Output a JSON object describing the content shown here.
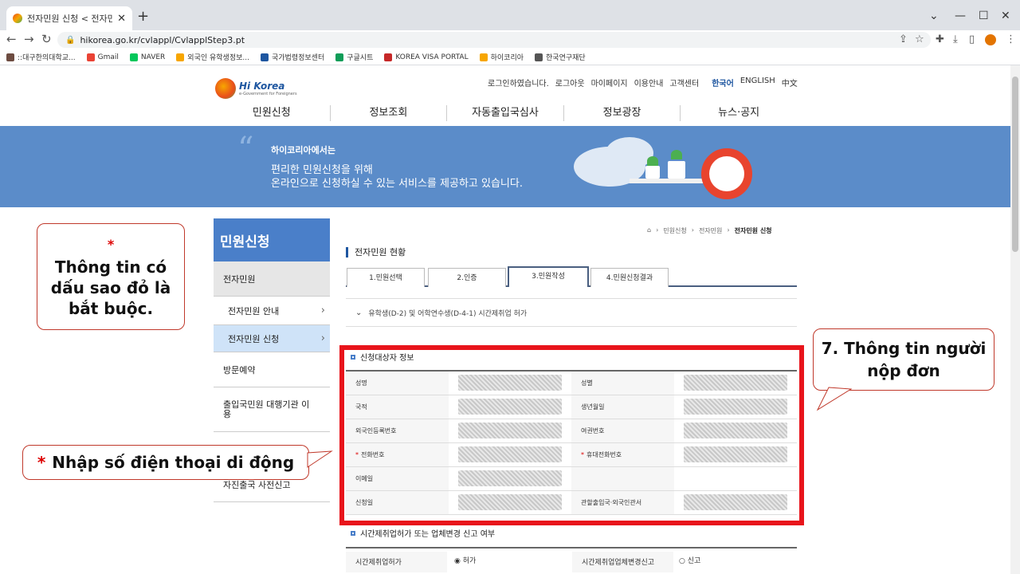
{
  "browser": {
    "tab_title": "전자민원 신청 < 전자민원 < 하",
    "url": "hikorea.go.kr/cvlappl/CvlapplStep3.pt",
    "bookmarks": [
      {
        "label": "::대구한의대학교...",
        "color": "#6d4c41"
      },
      {
        "label": "Gmail",
        "color": "#ea4335"
      },
      {
        "label": "NAVER",
        "color": "#03c75a"
      },
      {
        "label": "외국인 유학생정보...",
        "color": "#f7a600"
      },
      {
        "label": "국가법령정보센터",
        "color": "#1e56a0"
      },
      {
        "label": "구글시트",
        "color": "#0f9d58"
      },
      {
        "label": "KOREA VISA PORTAL",
        "color": "#c62828"
      },
      {
        "label": "하이코리아",
        "color": "#f7a600"
      },
      {
        "label": "한국연구재단",
        "color": "#555555"
      }
    ]
  },
  "header": {
    "logo_text": "Hi Korea",
    "logo_sub": "e-Government for Foreigners",
    "util": [
      "로그인하였습니다.",
      "로그아웃",
      "마이페이지",
      "이용안내",
      "고객센터"
    ],
    "langs": [
      "한국어",
      "ENGLISH",
      "中文"
    ],
    "gnb": [
      "민원신청",
      "정보조회",
      "자동출입국심사",
      "정보광장",
      "뉴스·공지"
    ]
  },
  "banner": {
    "heading": "하이코리아에서는",
    "line1": "편리한 민원신청을 위해",
    "line2": "온라인으로 신청하실 수 있는 서비스를 제공하고 있습니다."
  },
  "sidebar": {
    "title": "민원신청",
    "items": [
      "전자민원",
      "전자민원 안내",
      "전자민원 신청",
      "방문예약",
      "출입국민원 대행기관 이용",
      "자진출국 사전신고"
    ]
  },
  "content": {
    "breadcrumb": [
      "민원신청",
      "전자민원",
      "전자민원 신청"
    ],
    "section_title": "전자민원 현황",
    "tabs": [
      "1.민원선택",
      "2.인증",
      "3.민원작성",
      "4.민원신청결과"
    ],
    "subject": "유학생(D-2) 및 어학연수생(D-4-1) 시간제취업 허가",
    "block1_title": "신청대상자 정보",
    "rows": [
      {
        "l1": "성명",
        "l2": "성별",
        "req1": false,
        "req2": false
      },
      {
        "l1": "국적",
        "l2": "생년월일",
        "req1": false,
        "req2": false
      },
      {
        "l1": "외국인등록번호",
        "l2": "여권번호",
        "req1": false,
        "req2": false
      },
      {
        "l1": "전화번호",
        "l2": "휴대전화번호",
        "req1": true,
        "req2": true
      },
      {
        "l1": "이메일",
        "l2": "",
        "req1": false,
        "req2": false
      },
      {
        "l1": "신청일",
        "l2": "관할출입국·외국인관서",
        "req1": false,
        "req2": false
      }
    ],
    "block2_title": "시간제취업허가 또는 업체변경 신고 여부",
    "bottom_row": [
      "시간제취업허가",
      "허가",
      "시간제취업업체변경신고",
      "신고"
    ]
  },
  "callouts": {
    "c1_star": "*",
    "c1_text": "Thông tin có dấu sao đỏ là bắt buộc.",
    "c2_text": "7. Thông tin người nộp đơn",
    "c3_star": "*",
    "c3_text": "Nhập số điện thoại di động"
  },
  "colors": {
    "accent": "#4a7fc9",
    "highlight": "#e8141b"
  }
}
